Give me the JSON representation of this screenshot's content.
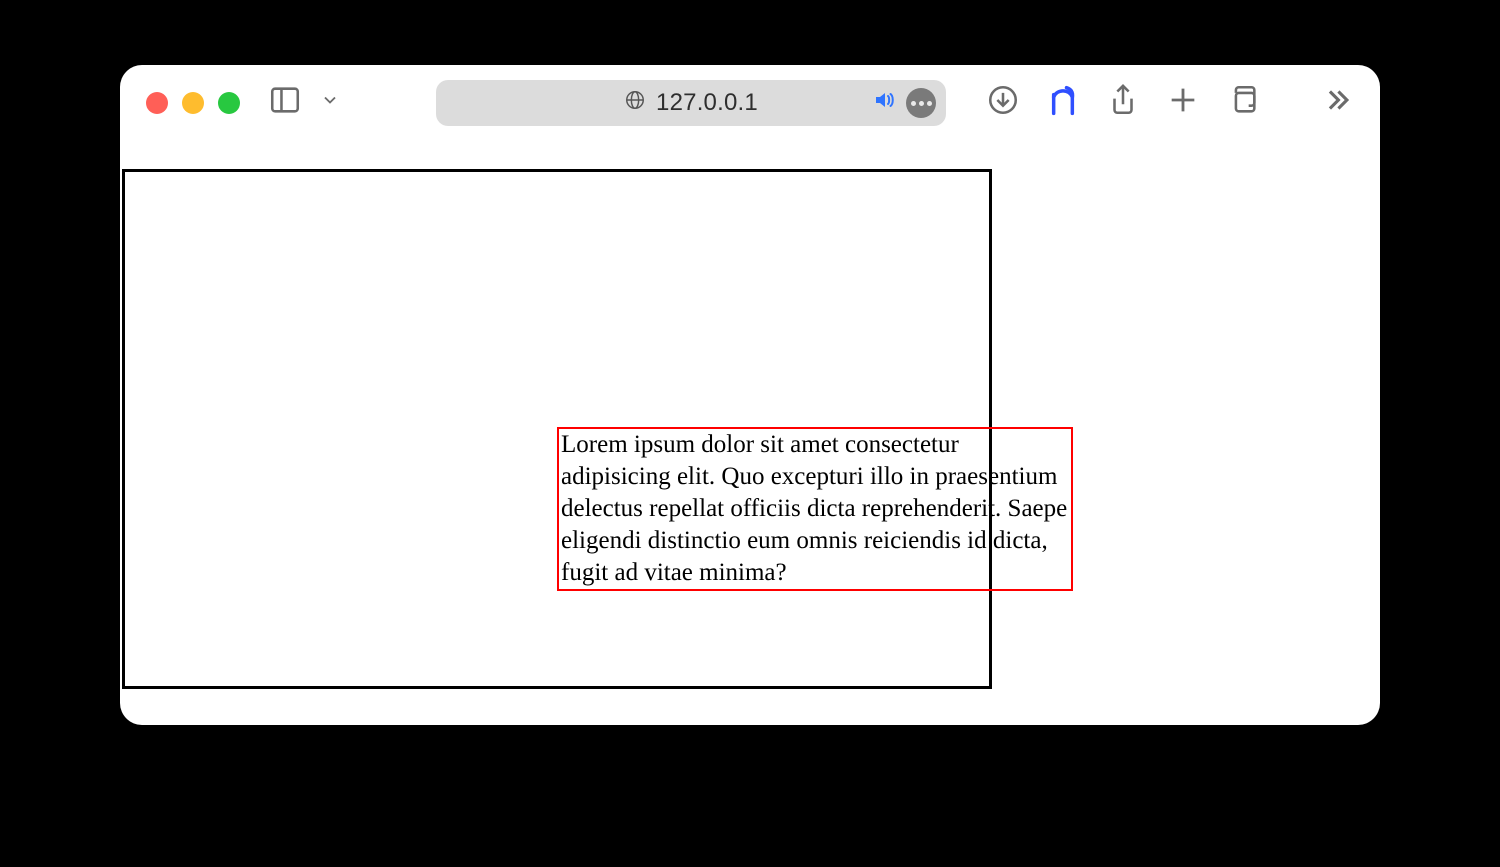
{
  "browser": {
    "address": "127.0.0.1"
  },
  "content": {
    "lorem": "Lorem ipsum dolor sit amet consectetur adipisicing elit. Quo excepturi illo in praesentium delectus repellat officiis dicta reprehenderit. Saepe eligendi distinctio eum omnis reiciendis id dicta, fugit ad vitae minima?"
  }
}
